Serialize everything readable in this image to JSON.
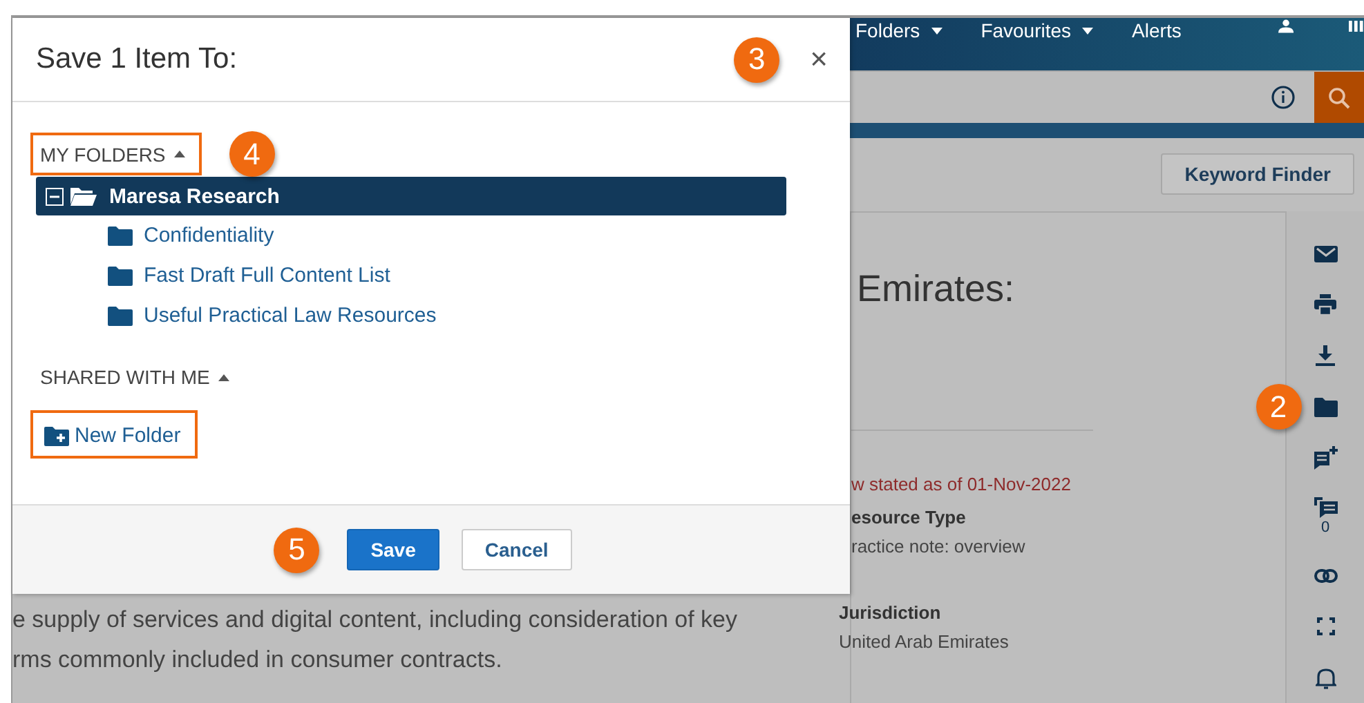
{
  "nav": [
    {
      "label": "Folders",
      "dropdown": true
    },
    {
      "label": "Favourites",
      "dropdown": true
    },
    {
      "label": "Alerts",
      "dropdown": false
    }
  ],
  "keyword_finder": "Keyword Finder",
  "document": {
    "heading": "Emirates:",
    "status": "w stated as of 01-Nov-2022",
    "resource_type_label": "esource Type",
    "resource_type": "ractice note: overview",
    "jurisdiction_label": "Jurisdiction",
    "jurisdiction": "United Arab Emirates",
    "summary": [
      "e supply of services and digital content, including consideration of key",
      "rms commonly included in consumer contracts."
    ]
  },
  "sidebar": [
    {
      "kind": "mail"
    },
    {
      "kind": "print"
    },
    {
      "kind": "download"
    },
    {
      "kind": "folder",
      "callout": "2"
    },
    {
      "kind": "add-note"
    },
    {
      "kind": "notes",
      "count": "0"
    },
    {
      "kind": "link"
    },
    {
      "kind": "fullscreen"
    },
    {
      "kind": "bell"
    }
  ],
  "dialog": {
    "title": "Save 1 Item To:",
    "close": "×",
    "close_callout": "3",
    "sections": [
      {
        "label": "MY FOLDERS",
        "expanded": true,
        "highlighted": true,
        "callout": "4",
        "folders": [
          {
            "name": "Maresa Research",
            "selected": true,
            "expanded": true,
            "children": [
              {
                "name": "Confidentiality",
                "selected": false
              },
              {
                "name": "Fast Draft Full Content List",
                "selected": false
              },
              {
                "name": "Useful Practical Law Resources",
                "selected": false
              }
            ]
          }
        ]
      },
      {
        "label": "SHARED WITH ME",
        "expanded": true,
        "highlighted": false
      }
    ],
    "new_folder": {
      "label": "New Folder",
      "highlighted": true
    },
    "footer_callout": "5",
    "buttons": [
      {
        "label": "Save",
        "kind": "primary"
      },
      {
        "label": "Cancel",
        "kind": "secondary"
      }
    ]
  }
}
